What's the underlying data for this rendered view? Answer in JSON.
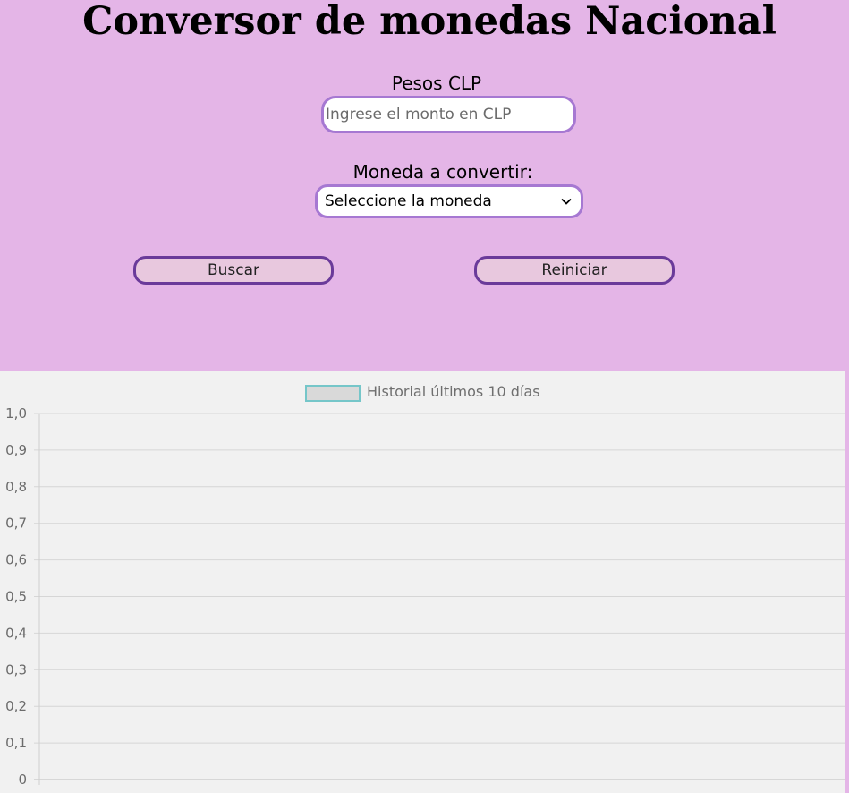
{
  "header": {
    "title": "Conversor de monedas Nacional"
  },
  "form": {
    "amount_label": "Pesos CLP",
    "amount_placeholder": "Ingrese el monto en CLP",
    "amount_value": "",
    "currency_label": "Moneda a convertir:",
    "currency_selected": "Seleccione la moneda",
    "search_button": "Buscar",
    "reset_button": "Reiniciar"
  },
  "colors": {
    "page_background": "#e4b5e7",
    "input_border": "#a678d2",
    "button_border": "#6a3a9a",
    "button_fill": "#e8c8de",
    "chart_background": "#f1f1f1",
    "legend_border": "#75c6c9"
  },
  "icons": {
    "select_arrow": "chevron-down-icon"
  },
  "chart_data": {
    "type": "line",
    "title": "",
    "legend_position": "top-center",
    "series": [
      {
        "name": "Historial últimos 10 días",
        "values": []
      }
    ],
    "categories": [],
    "ylim": [
      0,
      1
    ],
    "y_ticks": [
      "0",
      "0,1",
      "0,2",
      "0,3",
      "0,4",
      "0,5",
      "0,6",
      "0,7",
      "0,8",
      "0,9",
      "1,0"
    ],
    "grid": true
  }
}
